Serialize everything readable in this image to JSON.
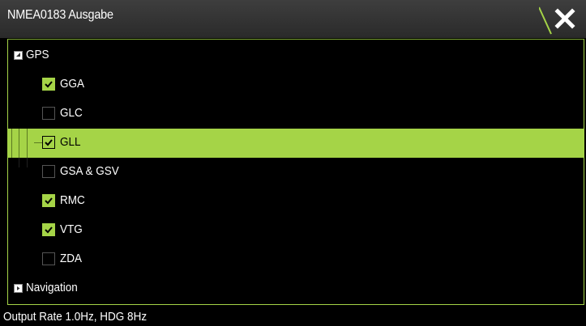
{
  "window": {
    "title": "NMEA0183 Ausgabe"
  },
  "tree": {
    "groups": [
      {
        "label": "GPS",
        "expanded": true,
        "items": [
          {
            "label": "GGA",
            "checked": true,
            "selected": false
          },
          {
            "label": "GLC",
            "checked": false,
            "selected": false
          },
          {
            "label": "GLL",
            "checked": true,
            "selected": true
          },
          {
            "label": "GSA & GSV",
            "checked": false,
            "selected": false
          },
          {
            "label": "RMC",
            "checked": true,
            "selected": false
          },
          {
            "label": "VTG",
            "checked": true,
            "selected": false
          },
          {
            "label": "ZDA",
            "checked": false,
            "selected": false
          }
        ]
      },
      {
        "label": "Navigation",
        "expanded": false,
        "items": []
      }
    ]
  },
  "footer": {
    "status": "Output Rate 1.0Hz, HDG 8Hz"
  },
  "colors": {
    "accent": "#a5d447",
    "titlebar": "#333333",
    "background": "#000000"
  },
  "icons": {
    "close": "close-icon",
    "collapse": "collapse-triangle-icon",
    "expand": "expand-triangle-icon",
    "check": "checkmark-icon"
  }
}
